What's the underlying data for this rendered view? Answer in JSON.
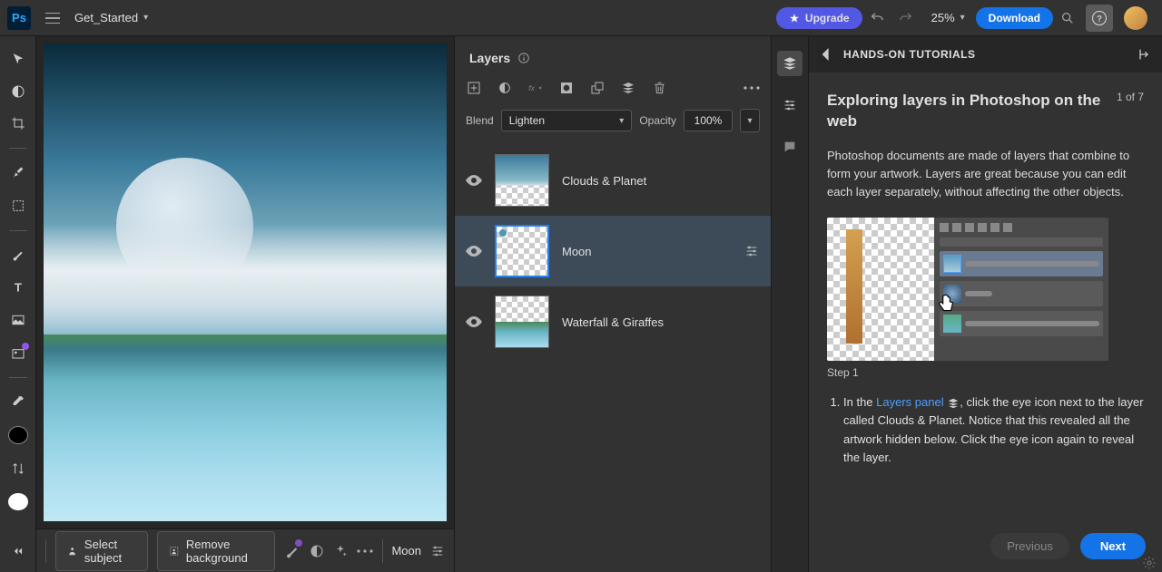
{
  "header": {
    "doc_name": "Get_Started",
    "upgrade": "Upgrade",
    "zoom": "25%",
    "download": "Download"
  },
  "layers_panel": {
    "title": "Layers",
    "blend_label": "Blend",
    "blend_value": "Lighten",
    "opacity_label": "Opacity",
    "opacity_value": "100%",
    "layers": [
      {
        "name": "Clouds & Planet"
      },
      {
        "name": "Moon"
      },
      {
        "name": "Waterfall & Giraffes"
      }
    ]
  },
  "footer": {
    "select_subject": "Select subject",
    "remove_bg": "Remove background",
    "layer_label": "Moon"
  },
  "tutorial": {
    "breadcrumb": "HANDS-ON TUTORIALS",
    "title": "Exploring layers in Photoshop on the web",
    "step": "1 of 7",
    "description": "Photoshop documents are made of layers that combine to form your artwork. Layers are great because you can edit each layer separately, without affecting the other objects.",
    "caption": "Step 1",
    "list_prefix": "In the ",
    "list_link": "Layers panel",
    "list_suffix": ", click the eye icon next to the layer called Clouds & Planet. Notice that this revealed all the artwork hidden below. Click the eye icon again to reveal the layer.",
    "previous": "Previous",
    "next": "Next"
  }
}
